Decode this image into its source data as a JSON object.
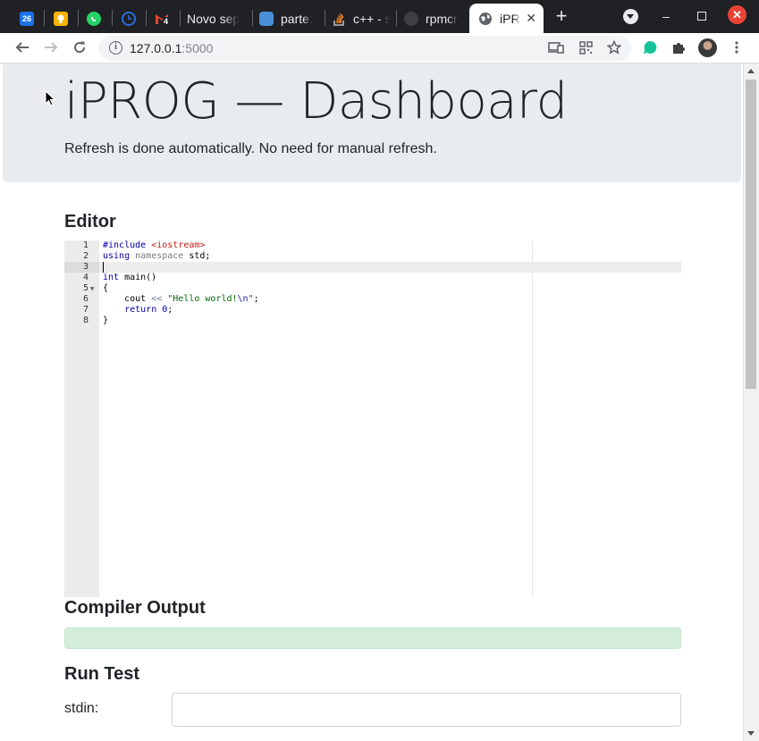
{
  "browser": {
    "tabs": [
      {
        "title": "",
        "icon": "calendar-icon",
        "color": "#1a73e8"
      },
      {
        "title": "",
        "icon": "keep-icon",
        "color": "#f6b400"
      },
      {
        "title": "",
        "icon": "whatsapp-icon",
        "color": "#25d366"
      },
      {
        "title": "",
        "icon": "timer-icon",
        "color": "#2b6cdf"
      },
      {
        "title": "",
        "icon": "gmail-icon",
        "color": "#ea4335"
      },
      {
        "title": "Novo sep",
        "icon": "",
        "color": ""
      },
      {
        "title": "parte:",
        "icon": "site-icon",
        "color": "#4a90d9"
      },
      {
        "title": "c++ - s",
        "icon": "stackoverflow-icon",
        "color": "#f48024"
      },
      {
        "title": "rpmcr",
        "icon": "github-icon",
        "color": "#5f6368"
      },
      {
        "title": "iPR",
        "icon": "globe-icon",
        "color": "#5f6368"
      }
    ],
    "gmail_badge": "4",
    "calendar_day": "26",
    "url_host": "127.0.0.1",
    "url_port": ":5000"
  },
  "header": {
    "title": "iPROG — Dashboard",
    "subtitle": "Refresh is done automatically. No need for manual refresh."
  },
  "editor": {
    "heading": "Editor",
    "current_line": 3,
    "lines": [
      {
        "num": "1",
        "fold": false
      },
      {
        "num": "2",
        "fold": false
      },
      {
        "num": "3",
        "fold": false
      },
      {
        "num": "4",
        "fold": false
      },
      {
        "num": "5",
        "fold": true
      },
      {
        "num": "6",
        "fold": false
      },
      {
        "num": "7",
        "fold": false
      },
      {
        "num": "8",
        "fold": false
      }
    ],
    "code": {
      "l1_directive": "#include",
      "l1_header": "<iostream>",
      "l2_using": "using",
      "l2_namespace": "namespace",
      "l2_rest": " std;",
      "l4_type": "int",
      "l4_rest": " main()",
      "l5": "{",
      "l6_indent": "    cout ",
      "l6_op": "<<",
      "l6_str_a": " \"Hello world!",
      "l6_escape": "\\n",
      "l6_str_b": "\"",
      "l6_end": ";",
      "l7_indent": "    ",
      "l7_kw": "return",
      "l7_num": " 0",
      "l7_end": ";",
      "l8": "}"
    }
  },
  "compiler": {
    "heading": "Compiler Output",
    "output": ""
  },
  "run_test": {
    "heading": "Run Test",
    "stdin_label": "stdin:",
    "stdin_value": ""
  }
}
